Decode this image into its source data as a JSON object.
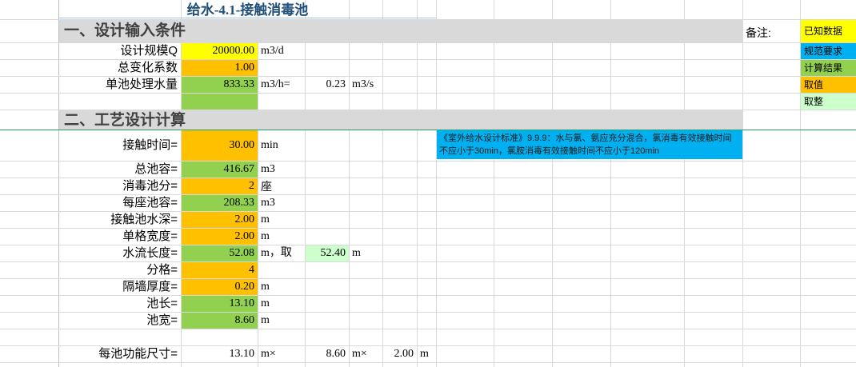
{
  "sheet": {
    "title": "给水-4.1-接触消毒池",
    "section1": "一、设计输入条件",
    "section2": "二、工艺设计计算",
    "note_label": "备注:",
    "legend": [
      "已知数据",
      "规范要求",
      "计算结果",
      "取值",
      "取整"
    ],
    "input": {
      "scale_label": "设计规模Q",
      "scale_value": "20000.00",
      "scale_unit": "m3/d",
      "coef_label": "总变化系数",
      "coef_value": "1.00",
      "flow_label": "单池处理水量",
      "flow_value": "833.33",
      "flow_unit": "m3/h=",
      "flow_value2": "0.23",
      "flow_unit2": "m3/s"
    },
    "calc": {
      "contact_time_label": "接触时间=",
      "contact_time_value": "30.00",
      "contact_time_unit": "min",
      "spec_note": "《室外给水设计标准》9.9.9：水与氯、氨应充分混合，氯消毒有效接触时间不应小于30min，氯胺消毒有效接触时间不应小于120min",
      "total_volume_label": "总池容=",
      "total_volume_value": "416.67",
      "total_volume_unit": "m3",
      "tanks_label": "消毒池分=",
      "tanks_value": "2",
      "tanks_unit": "座",
      "tank_volume_label": "每座池容=",
      "tank_volume_value": "208.33",
      "tank_volume_unit": "m3",
      "depth_label": "接触池水深=",
      "depth_value": "2.00",
      "depth_unit": "m",
      "width_label": "单格宽度=",
      "width_value": "2.00",
      "width_unit": "m",
      "flow_length_label": "水流长度=",
      "flow_length_value": "52.08",
      "flow_length_unit": "m，取",
      "flow_length_taken": "52.40",
      "flow_length_taken_unit": "m",
      "cells_label": "分格=",
      "cells_value": "4",
      "wall_label": "隔墙厚度=",
      "wall_value": "0.20",
      "wall_unit": "m",
      "length_label": "池长=",
      "length_value": "13.10",
      "length_unit": "m",
      "pwidth_label": "池宽=",
      "pwidth_value": "8.60",
      "pwidth_unit": "m",
      "dim_label": "每池功能尺寸=",
      "dim_l": "13.10",
      "dim_l_unit": "m×",
      "dim_w": "8.60",
      "dim_w_unit": "m×",
      "dim_h": "2.00",
      "dim_h_unit": "m"
    }
  }
}
